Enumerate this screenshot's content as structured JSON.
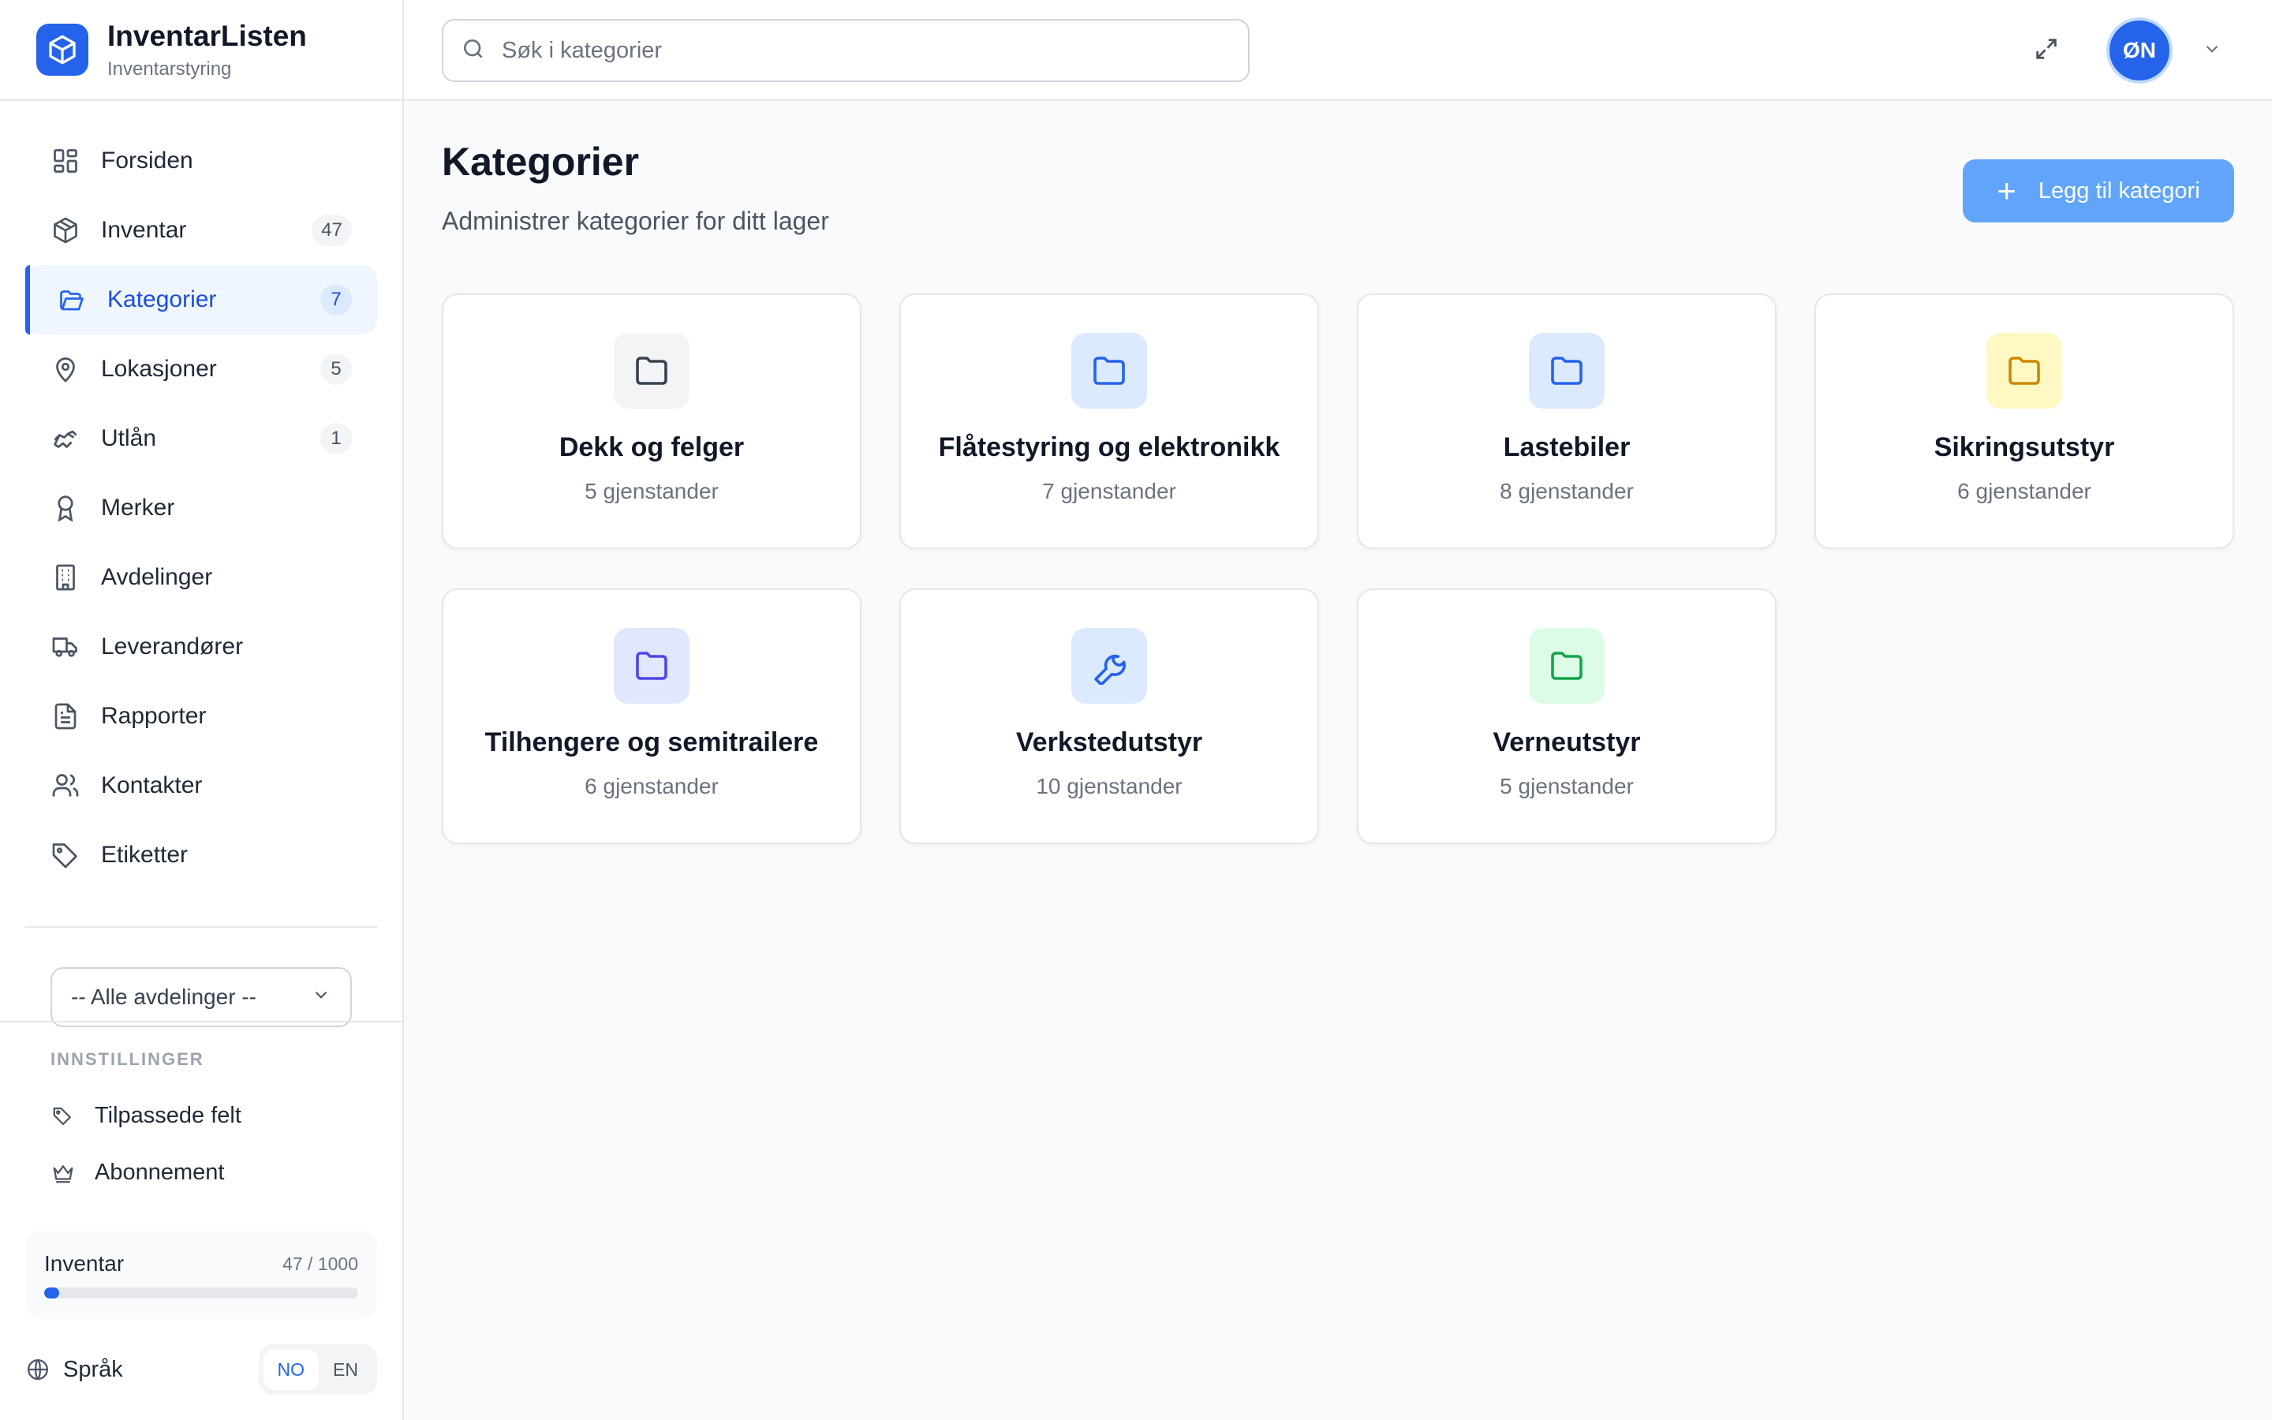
{
  "brand": {
    "title": "InventarListen",
    "subtitle": "Inventarstyring"
  },
  "nav": [
    {
      "label": "Forsiden",
      "badge": "",
      "icon": "grid-icon"
    },
    {
      "label": "Inventar",
      "badge": "47",
      "icon": "box-icon"
    },
    {
      "label": "Kategorier",
      "badge": "7",
      "icon": "folder-open-icon",
      "active": true
    },
    {
      "label": "Lokasjoner",
      "badge": "5",
      "icon": "map-pin-icon"
    },
    {
      "label": "Utlån",
      "badge": "1",
      "icon": "handshake-icon"
    },
    {
      "label": "Merker",
      "badge": "",
      "icon": "award-icon"
    },
    {
      "label": "Avdelinger",
      "badge": "",
      "icon": "building-icon"
    },
    {
      "label": "Leverandører",
      "badge": "",
      "icon": "truck-icon"
    },
    {
      "label": "Rapporter",
      "badge": "",
      "icon": "file-text-icon"
    },
    {
      "label": "Kontakter",
      "badge": "",
      "icon": "users-icon"
    },
    {
      "label": "Etiketter",
      "badge": "",
      "icon": "tag-icon"
    }
  ],
  "department_select": {
    "value": "-- Alle avdelinger --"
  },
  "settings": {
    "title": "INNSTILLINGER",
    "items": [
      {
        "label": "Tilpassede felt",
        "icon": "tags-icon"
      },
      {
        "label": "Abonnement",
        "icon": "crown-icon"
      }
    ]
  },
  "usage": {
    "label": "Inventar",
    "count": "47 / 1000",
    "fraction": 0.047
  },
  "language": {
    "label": "Språk",
    "options": [
      "NO",
      "EN"
    ],
    "selected": "NO"
  },
  "search": {
    "placeholder": "Søk i kategorier"
  },
  "user": {
    "initials": "ØN"
  },
  "page": {
    "title": "Kategorier",
    "subtitle": "Administrer kategorier for ditt lager",
    "add_button": "Legg til kategori"
  },
  "categories": [
    {
      "name": "Dekk og felger",
      "count": "5 gjenstander",
      "icon": "folder-icon",
      "color": "#374151",
      "bg": "#f3f4f6"
    },
    {
      "name": "Flåtestyring og elektronikk",
      "count": "7 gjenstander",
      "icon": "folder-icon",
      "color": "#2563eb",
      "bg": "#dbeafe"
    },
    {
      "name": "Lastebiler",
      "count": "8 gjenstander",
      "icon": "folder-icon",
      "color": "#2563eb",
      "bg": "#dbeafe"
    },
    {
      "name": "Sikringsutstyr",
      "count": "6 gjenstander",
      "icon": "folder-icon",
      "color": "#ca8a04",
      "bg": "#fef9c3"
    },
    {
      "name": "Tilhengere og semitrailere",
      "count": "6 gjenstander",
      "icon": "folder-icon",
      "color": "#4f46e5",
      "bg": "#e0e7ff"
    },
    {
      "name": "Verkstedutstyr",
      "count": "10 gjenstander",
      "icon": "wrench-icon",
      "color": "#2563eb",
      "bg": "#dbeafe"
    },
    {
      "name": "Verneutstyr",
      "count": "5 gjenstander",
      "icon": "folder-icon",
      "color": "#16a34a",
      "bg": "#dcfce7"
    }
  ]
}
